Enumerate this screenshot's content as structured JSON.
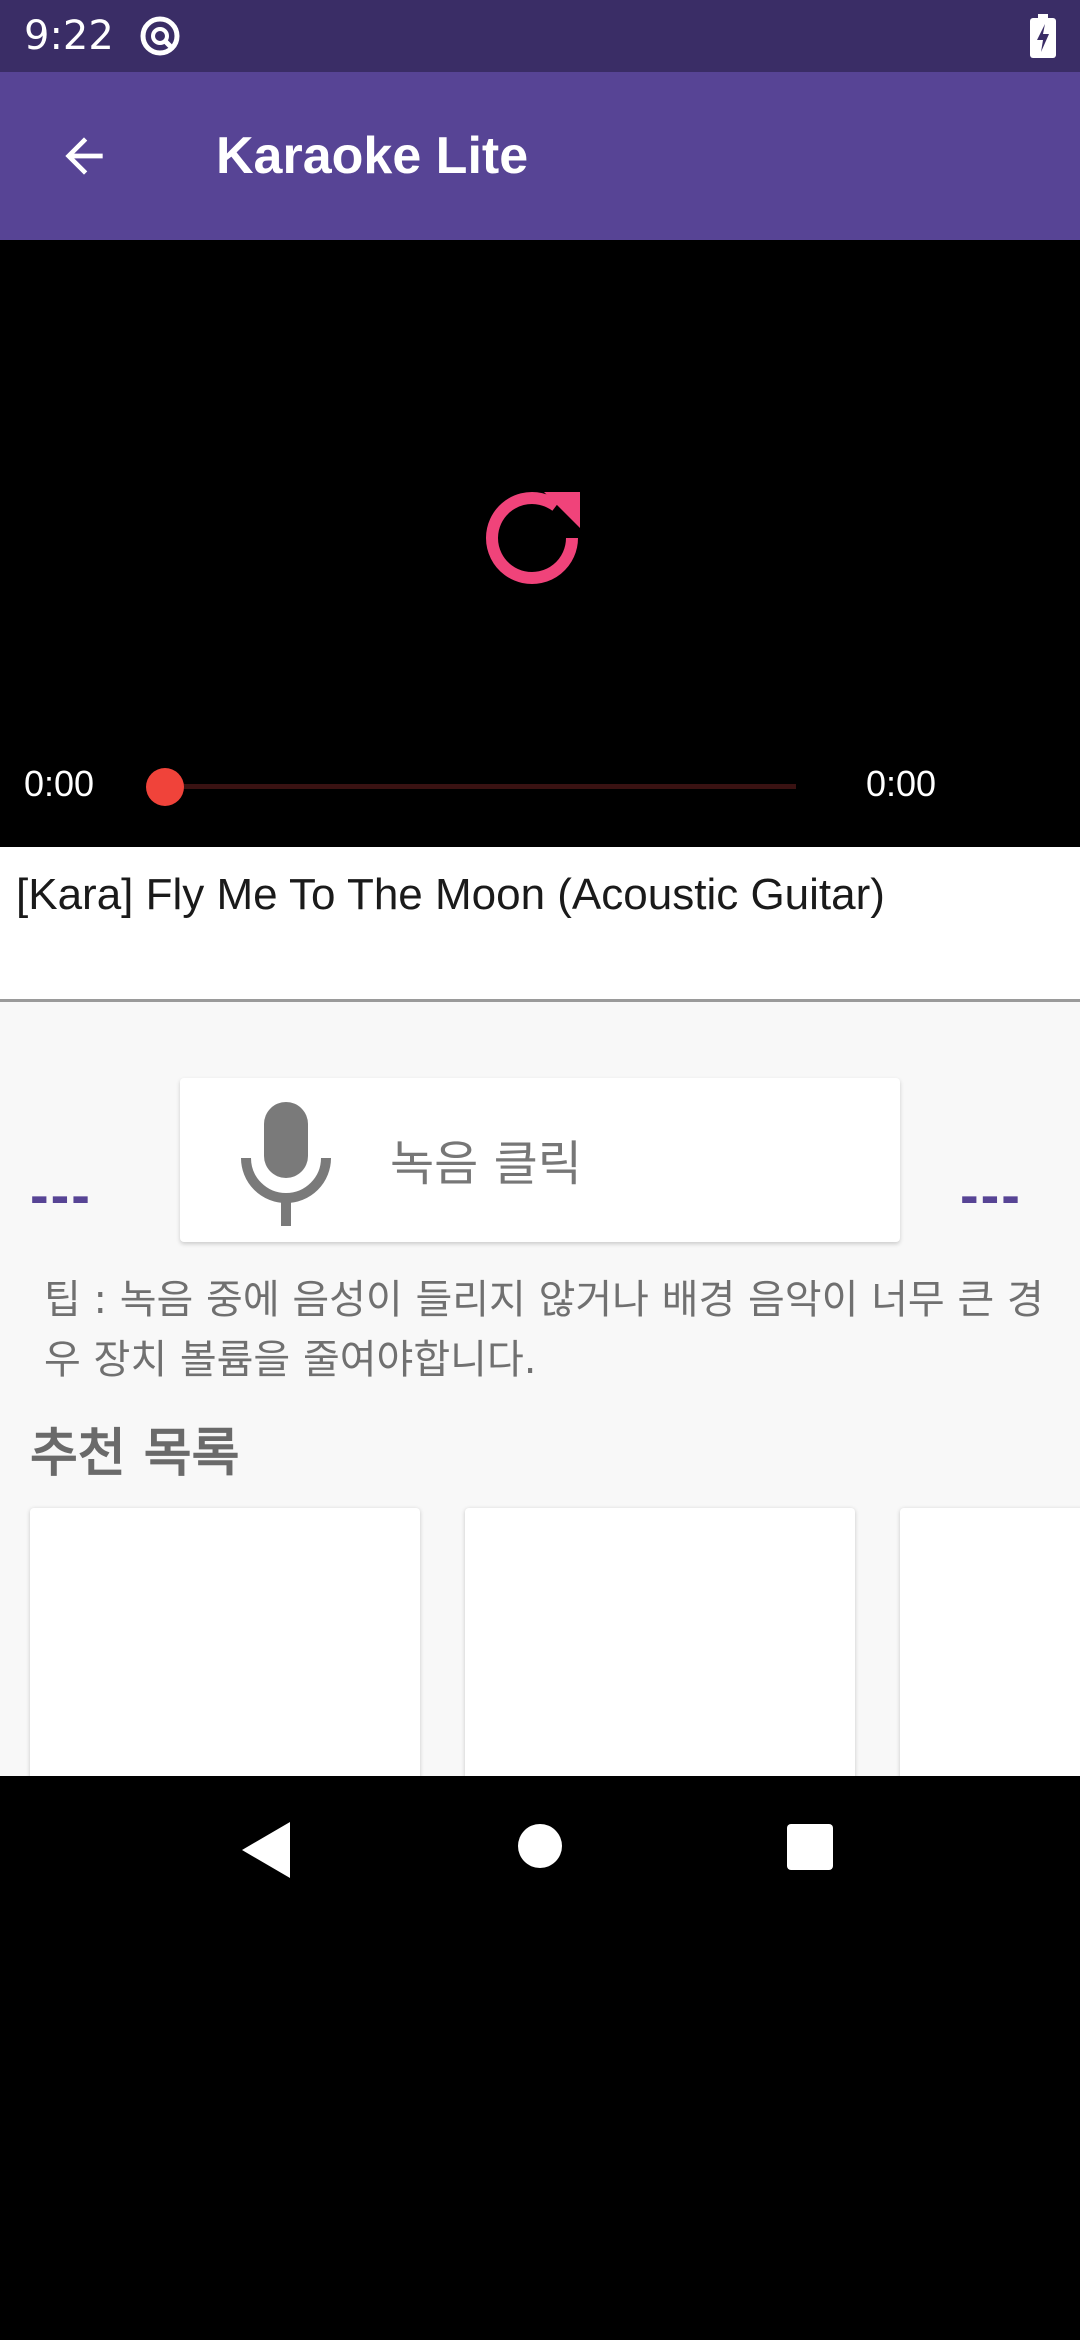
{
  "status_bar": {
    "time": "9:22",
    "app_icon": "sync-icon",
    "battery_icon": "battery-charging-icon"
  },
  "app_bar": {
    "title": "Karaoke Lite",
    "back_icon": "arrow-left-icon"
  },
  "player": {
    "current_time": "0:00",
    "total_time": "0:00",
    "progress": 0,
    "replay_icon": "replay-icon",
    "fullscreen_icon": "fullscreen-icon",
    "accent_color": "#f0437a"
  },
  "video": {
    "title": "[Kara] Fly Me To The Moon (Acoustic Guitar)"
  },
  "recorder": {
    "level_left": "---",
    "level_right": "---",
    "label": "녹음 클릭",
    "mic_icon": "microphone-icon",
    "tip": "팁 : 녹음 중에 음성이 들리지 않거나 배경 음악이 너무 큰 경우 장치 볼륨을 줄여야합니다."
  },
  "recommendations": {
    "title": "추천 목록",
    "items": [
      {},
      {},
      {}
    ]
  },
  "colors": {
    "primary": "#574495",
    "primary_dark": "#3a2d66",
    "seek": "#f0433a"
  },
  "nav_bar": {
    "back_icon": "nav-back-icon",
    "home_icon": "nav-home-icon",
    "recents_icon": "nav-recents-icon"
  }
}
